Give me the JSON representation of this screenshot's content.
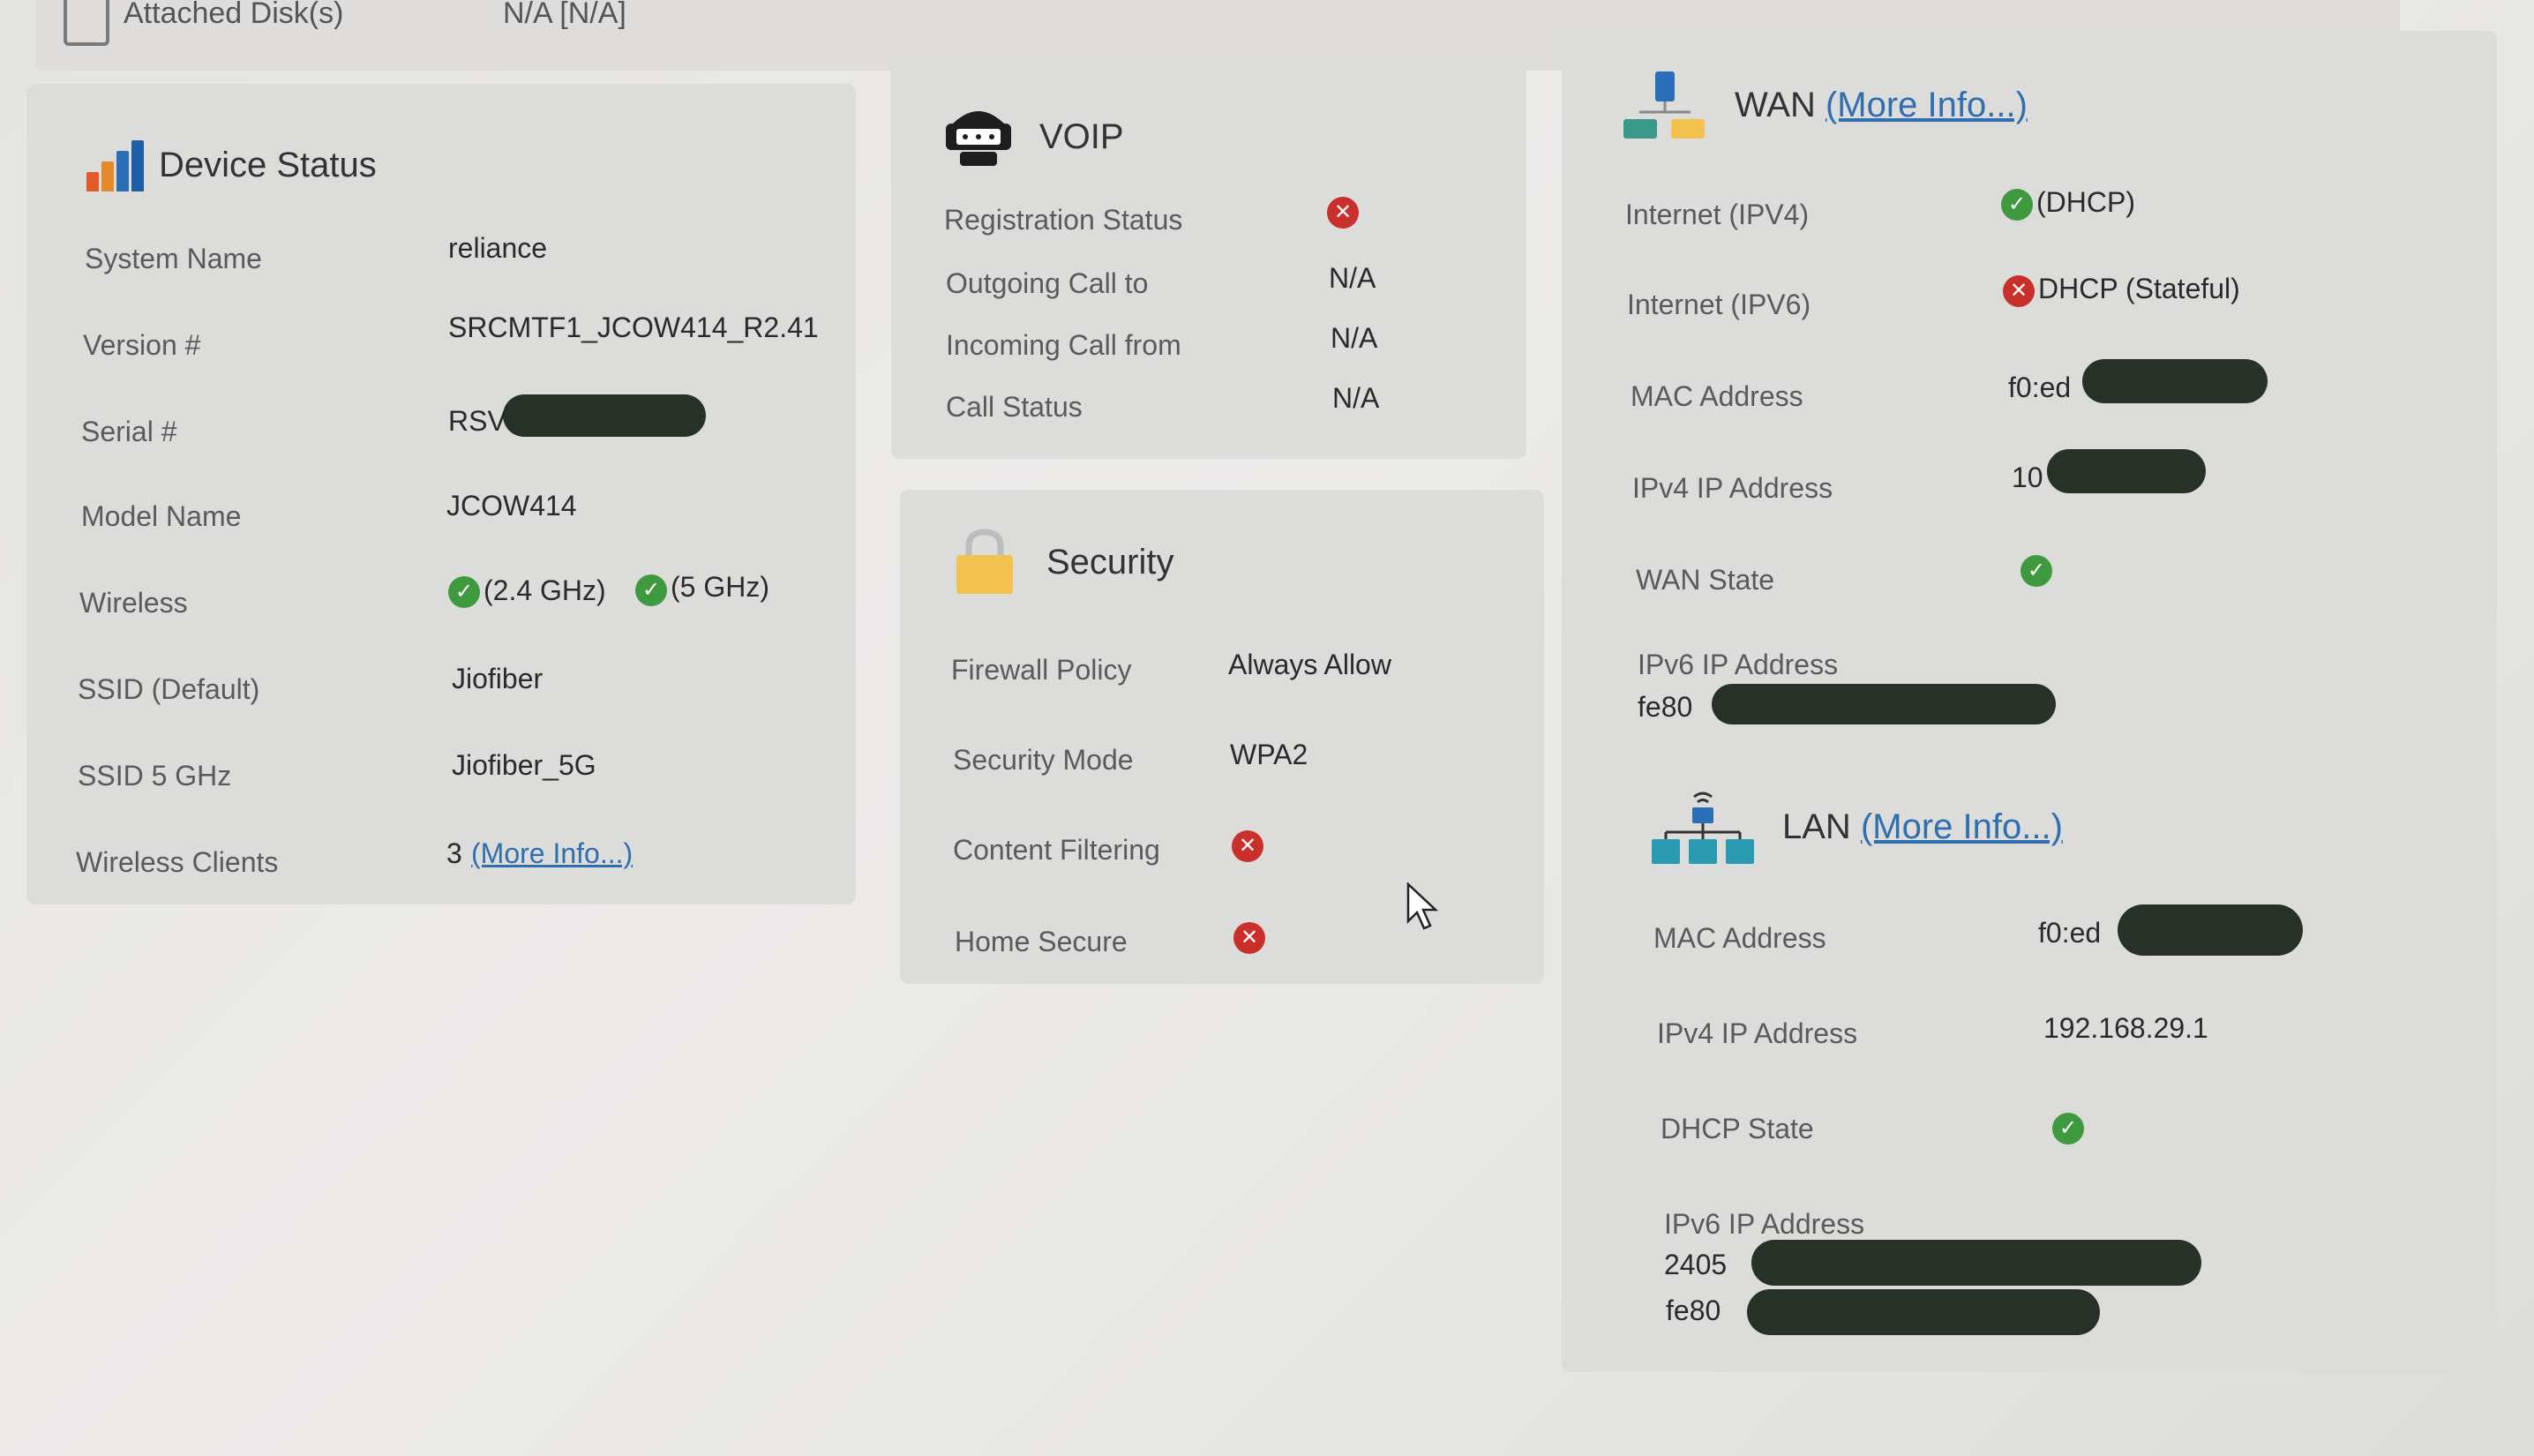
{
  "top": {
    "disk_label": "Attached Disk(s)",
    "disk_value": "N/A [N/A]"
  },
  "device_status": {
    "title": "Device Status",
    "rows": {
      "system_name": {
        "label": "System Name",
        "value": "reliance"
      },
      "version": {
        "label": "Version #",
        "value": "SRCMTF1_JCOW414_R2.41"
      },
      "serial": {
        "label": "Serial #",
        "value": "RSV"
      },
      "model_name": {
        "label": "Model Name",
        "value": "JCOW414"
      },
      "wireless": {
        "label": "Wireless",
        "band1": "(2.4 GHz)",
        "band2": "(5 GHz)"
      },
      "ssid_default": {
        "label": "SSID (Default)",
        "value": "Jiofiber"
      },
      "ssid_5ghz": {
        "label": "SSID 5 GHz",
        "value": "Jiofiber_5G"
      },
      "wireless_clients": {
        "label": "Wireless Clients",
        "count": "3",
        "link": "(More Info...)"
      }
    }
  },
  "voip": {
    "title": "VOIP",
    "rows": {
      "registration": {
        "label": "Registration Status",
        "status": "error"
      },
      "outgoing": {
        "label": "Outgoing Call to",
        "value": "N/A"
      },
      "incoming": {
        "label": "Incoming Call from",
        "value": "N/A"
      },
      "call_status": {
        "label": "Call Status",
        "value": "N/A"
      }
    }
  },
  "security": {
    "title": "Security",
    "rows": {
      "firewall": {
        "label": "Firewall Policy",
        "value": "Always Allow"
      },
      "mode": {
        "label": "Security Mode",
        "value": "WPA2"
      },
      "content_filtering": {
        "label": "Content Filtering",
        "status": "error"
      },
      "home_secure": {
        "label": "Home Secure",
        "status": "error"
      }
    }
  },
  "wan": {
    "title": "WAN",
    "link": "(More Info...)",
    "rows": {
      "ipv4": {
        "label": "Internet (IPV4)",
        "value": "(DHCP)",
        "status": "ok"
      },
      "ipv6": {
        "label": "Internet (IPV6)",
        "value": "DHCP (Stateful)",
        "status": "error"
      },
      "mac": {
        "label": "MAC Address",
        "value": "f0:ed"
      },
      "ipv4_ip": {
        "label": "IPv4 IP Address",
        "value": "10"
      },
      "state": {
        "label": "WAN State",
        "status": "ok"
      },
      "ipv6_ip": {
        "label": "IPv6 IP Address",
        "value": "fe80"
      }
    }
  },
  "lan": {
    "title": "LAN",
    "link": "(More Info...)",
    "rows": {
      "mac": {
        "label": "MAC Address",
        "value": "f0:ed"
      },
      "ipv4_ip": {
        "label": "IPv4 IP Address",
        "value": "192.168.29.1"
      },
      "dhcp_state": {
        "label": "DHCP State",
        "status": "ok"
      },
      "ipv6_ip": {
        "label": "IPv6 IP Address",
        "value1": "2405",
        "value2": "fe80"
      }
    }
  },
  "colors": {
    "ok": "#3f9a3f",
    "error": "#c9302c",
    "link": "#2f6fb0",
    "panel": "#dcdcda"
  }
}
